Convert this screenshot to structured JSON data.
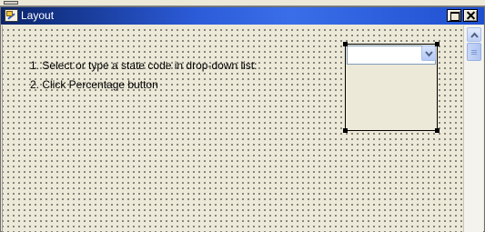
{
  "window": {
    "title": "Layout",
    "title_icon": "form-edit-icon",
    "controls": [
      "maximize-icon",
      "close-icon"
    ]
  },
  "canvas": {
    "instructions": [
      "1. Select or type a state code in drop-down list:",
      "2. Click Percentage button"
    ],
    "grid": "dotted"
  },
  "combo": {
    "value": "",
    "icon": "chevron-down-icon",
    "selected": true
  },
  "scrollbar": {
    "icon": "chevron-up-icon"
  },
  "colors": {
    "titlebar": "#2c5bd8",
    "canvas": "#ece9d8",
    "accent": "#7f9db9"
  }
}
